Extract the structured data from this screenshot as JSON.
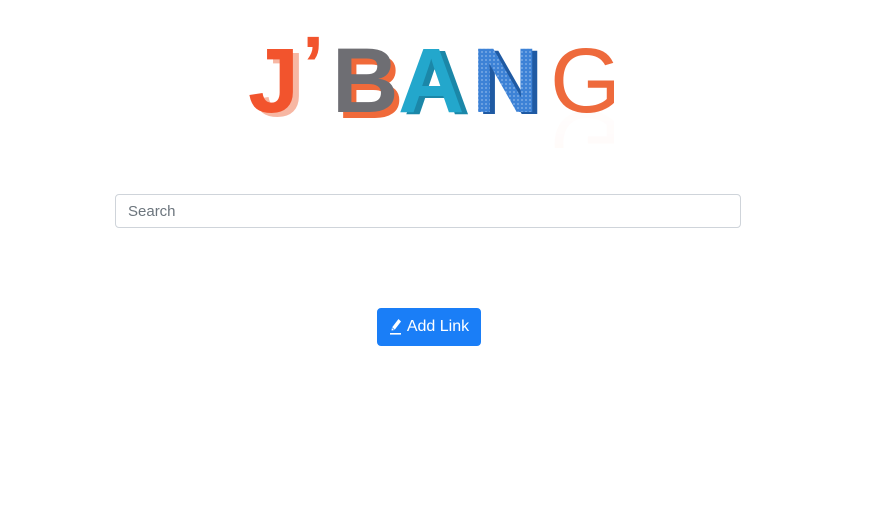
{
  "logo": {
    "letters": [
      "J",
      "’",
      "B",
      "A",
      "N",
      "G"
    ],
    "colors": {
      "j": "#f2542d",
      "b": "#6e6e73",
      "a": "#23a7cc",
      "n": "#2b6fc2",
      "g": "#ee6a3c",
      "shadow": "#f7b7a3"
    }
  },
  "search": {
    "value": "",
    "placeholder": "Search"
  },
  "add_button": {
    "label": "Add Link",
    "icon": "pen-nib-icon",
    "color": "#1a7ef7"
  }
}
